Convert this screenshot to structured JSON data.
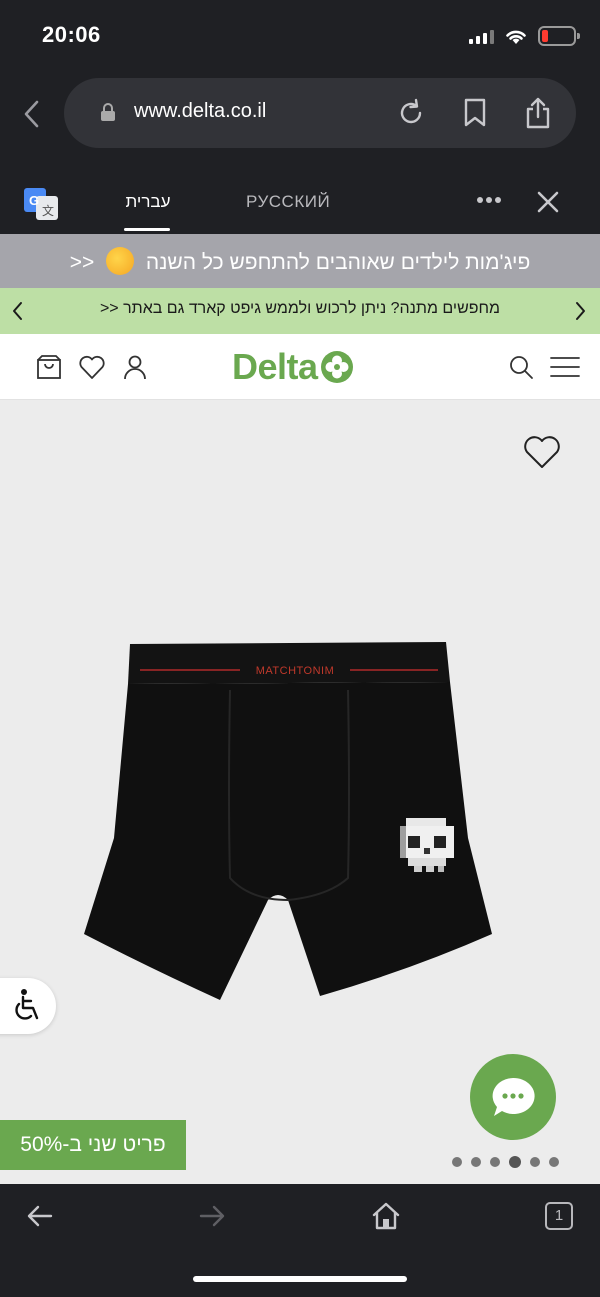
{
  "status_bar": {
    "time": "20:06"
  },
  "browser": {
    "url": "www.delta.co.il",
    "translate_tabs": {
      "hebrew": "עברית",
      "russian": "РУССКИЙ"
    }
  },
  "promo": {
    "gray_text": "פיג'מות לילדים שאוהבים להתחפש כל השנה",
    "gray_suffix": "<<",
    "green_text": "מחפשים מתנה? ניתן לרכוש ולממש גיפט קארד גם באתר <<"
  },
  "header": {
    "logo_text": "Delta"
  },
  "product": {
    "waistband_text": "MATCHTONIM",
    "sale_badge": "פריט שני ב-50%",
    "carousel": {
      "count": 6,
      "active_index": 3
    }
  },
  "bottom_bar": {
    "tabs_count": "1"
  },
  "colors": {
    "brand_green": "#6aa84f",
    "promo_green": "#bddfa5",
    "promo_gray": "#a5a5ab",
    "chrome_dark": "#1f2024"
  }
}
